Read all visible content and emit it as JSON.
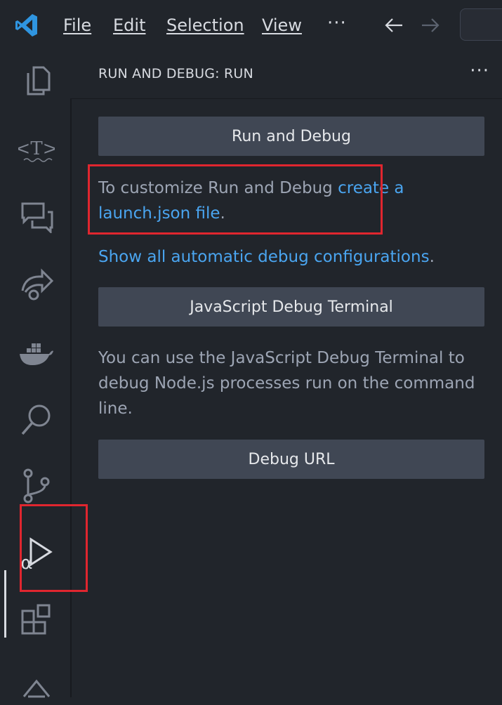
{
  "menu": {
    "file": "File",
    "edit": "Edit",
    "selection": "Selection",
    "view": "View",
    "more": "···"
  },
  "sidebar": {
    "title": "RUN AND DEBUG: RUN",
    "more": "···",
    "run_button": "Run and Debug",
    "customize_text": "To customize Run and Debug ",
    "customize_link": "create a launch.json file",
    "customize_period": ".",
    "show_link": "Show all automatic debug configurations",
    "show_period": ".",
    "js_terminal_button": "JavaScript Debug Terminal",
    "js_terminal_desc": "You can use the JavaScript Debug Terminal to debug Node.js processes run on the command line.",
    "debug_url_button": "Debug URL"
  },
  "colors": {
    "background": "#21252b",
    "button": "#404754",
    "link": "#4aa5f0",
    "highlight": "#e0262f",
    "vscode_blue": "#2f95e0"
  }
}
